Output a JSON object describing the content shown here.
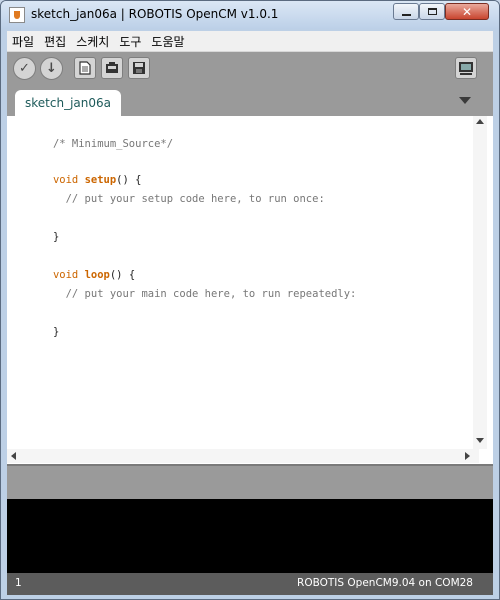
{
  "window": {
    "title": "sketch_jan06a | ROBOTIS OpenCM v1.0.1",
    "app_icon": "java-cup-icon",
    "controls": {
      "minimize": "minimize-icon",
      "maximize": "maximize-icon",
      "close": "✕"
    }
  },
  "menu": {
    "items": [
      "파일",
      "편집",
      "스케치",
      "도구",
      "도움말"
    ]
  },
  "toolbar": {
    "buttons": [
      "verify-icon",
      "upload-icon",
      "new-icon",
      "open-icon",
      "save-icon",
      "serial-monitor-icon"
    ],
    "verify_glyph": "✓",
    "upload_glyph": "↓"
  },
  "tabs": {
    "active": "sketch_jan06a"
  },
  "editor": {
    "lines": [
      {
        "comment": "/* Minimum_Source*/"
      },
      {
        "type": "void",
        "name": "setup",
        "rest": "() {"
      },
      {
        "comment": "  // put your setup code here, to run once:"
      },
      {
        "plain": "}"
      },
      {
        "type": "void",
        "name": "loop",
        "rest": "() {"
      },
      {
        "comment": "  // put your main code here, to run repeatedly:"
      },
      {
        "plain": "}"
      }
    ]
  },
  "status": {
    "line_number": "1",
    "board_port": "ROBOTIS OpenCM9.04 on COM28"
  },
  "colors": {
    "keyword": "#cc6600",
    "comment": "#777777",
    "toolbar_bg": "#9a9a9a",
    "console_bg": "#000000",
    "status_bg": "#5c5c5c"
  }
}
